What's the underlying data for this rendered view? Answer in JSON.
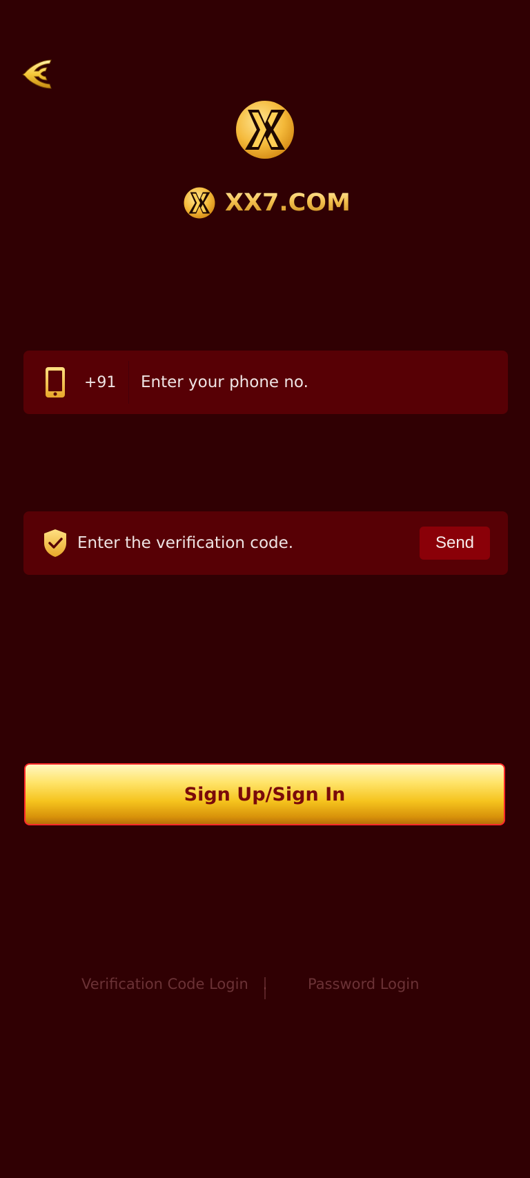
{
  "colors": {
    "background": "#300003",
    "field_background": "#570005",
    "gold": "#f3c04e",
    "button_text": "#7a0a0a"
  },
  "header": {
    "back_icon": "back-arrow-icon",
    "brand_name": "XX7.COM"
  },
  "phone_field": {
    "icon": "phone-icon",
    "country_code": "+91",
    "placeholder": "Enter your phone no.",
    "value": ""
  },
  "code_field": {
    "icon": "shield-check-icon",
    "placeholder": "Enter the verification code.",
    "value": "",
    "send_label": "Send"
  },
  "submit": {
    "label": "Sign Up/Sign In"
  },
  "login_options": {
    "verification_code_label": "Verification Code Login",
    "password_label": "Password Login"
  }
}
